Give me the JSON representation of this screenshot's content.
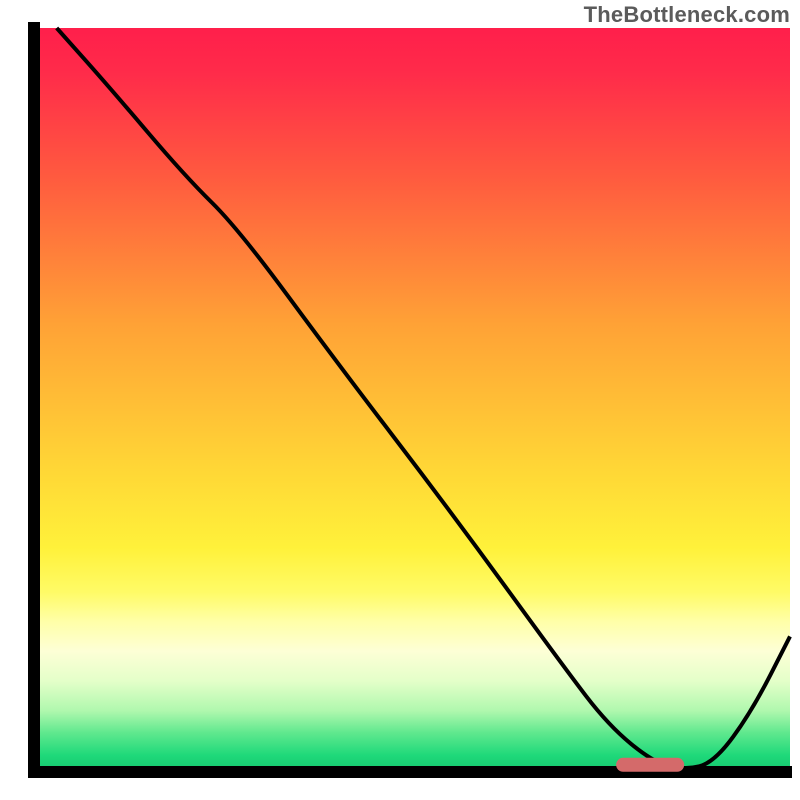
{
  "watermark": "TheBottleneck.com",
  "chart_data": {
    "type": "line",
    "title": "",
    "xlabel": "",
    "ylabel": "",
    "xlim": [
      0,
      100
    ],
    "ylim": [
      0,
      100
    ],
    "grid": false,
    "legend": false,
    "gradient_stops": [
      {
        "offset": 0.0,
        "color": "#ff1f4b"
      },
      {
        "offset": 0.06,
        "color": "#ff2b4a"
      },
      {
        "offset": 0.2,
        "color": "#ff5a3f"
      },
      {
        "offset": 0.4,
        "color": "#ffa236"
      },
      {
        "offset": 0.6,
        "color": "#ffd836"
      },
      {
        "offset": 0.7,
        "color": "#fff13a"
      },
      {
        "offset": 0.76,
        "color": "#fffb66"
      },
      {
        "offset": 0.8,
        "color": "#ffffa8"
      },
      {
        "offset": 0.84,
        "color": "#fdffd6"
      },
      {
        "offset": 0.88,
        "color": "#e4ffc9"
      },
      {
        "offset": 0.92,
        "color": "#b0f8ae"
      },
      {
        "offset": 0.95,
        "color": "#5fe88e"
      },
      {
        "offset": 0.98,
        "color": "#1fd97a"
      },
      {
        "offset": 1.0,
        "color": "#15c96f"
      }
    ],
    "series": [
      {
        "name": "curve",
        "x": [
          3,
          10,
          20,
          27,
          40,
          55,
          70,
          76,
          82,
          86,
          90,
          95,
          100
        ],
        "y": [
          100,
          92,
          80,
          73,
          55,
          35,
          14,
          6,
          1,
          0,
          1,
          8,
          18
        ]
      }
    ],
    "marker": {
      "x_start": 77,
      "x_end": 86,
      "y": 0.7
    }
  }
}
